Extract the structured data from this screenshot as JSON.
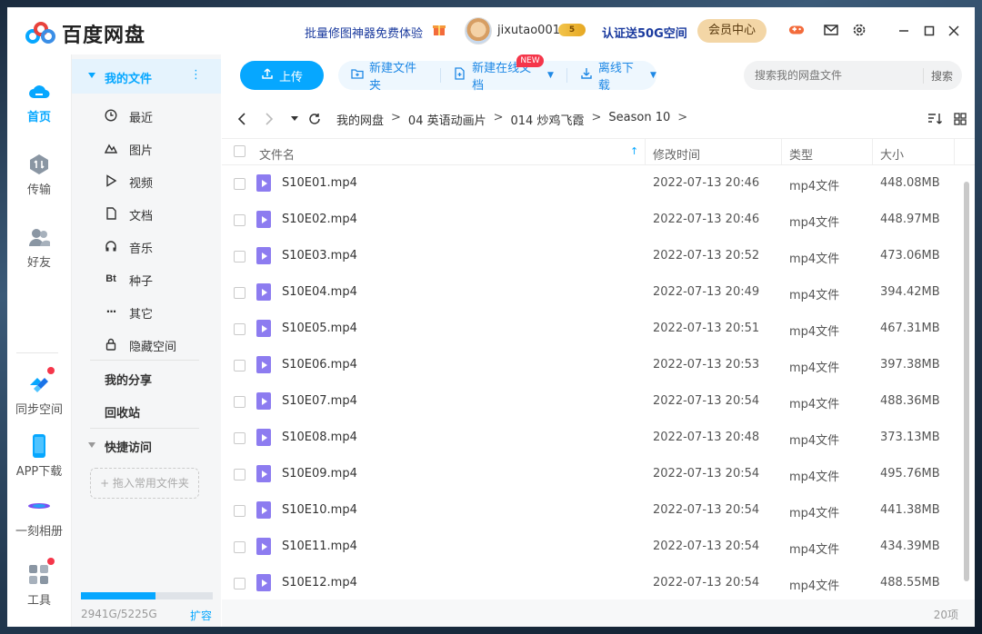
{
  "app": {
    "title": "百度网盘"
  },
  "header": {
    "promo": "批量修图神器免费体验",
    "username": "jixutao001",
    "level": "5",
    "verify_text": "认证送50G空间",
    "vip_button": "会员中心"
  },
  "rail": {
    "items": [
      {
        "label": "首页",
        "icon": "cloud-home-icon"
      },
      {
        "label": "传输",
        "icon": "transfer-icon"
      },
      {
        "label": "好友",
        "icon": "friends-icon"
      },
      {
        "label": "同步空间",
        "icon": "sync-space-icon"
      },
      {
        "label": "APP下载",
        "icon": "phone-icon"
      },
      {
        "label": "一刻相册",
        "icon": "album-icon"
      },
      {
        "label": "工具",
        "icon": "tools-icon"
      }
    ]
  },
  "sidebar": {
    "my_files": "我的文件",
    "sub_items": [
      {
        "label": "最近",
        "icon": "clock-icon"
      },
      {
        "label": "图片",
        "icon": "image-icon"
      },
      {
        "label": "视频",
        "icon": "video-icon"
      },
      {
        "label": "文档",
        "icon": "document-icon"
      },
      {
        "label": "音乐",
        "icon": "music-icon"
      },
      {
        "label": "种子",
        "icon": "torrent-icon"
      },
      {
        "label": "其它",
        "icon": "more-icon"
      },
      {
        "label": "隐藏空间",
        "icon": "lock-icon"
      }
    ],
    "my_share": "我的分享",
    "recycle": "回收站",
    "quick_access": "快捷访问",
    "drop_hint": "+ 拖入常用文件夹",
    "storage_text": "2941G/5225G",
    "storage_used_fraction": 0.563,
    "expand": "扩容"
  },
  "toolbar": {
    "upload": "上传",
    "new_folder": "新建文件夹",
    "new_online_doc": "新建在线文档",
    "new_badge": "NEW",
    "offline_download": "离线下载",
    "search_placeholder": "搜索我的网盘文件",
    "search_button": "搜索"
  },
  "breadcrumb": [
    "我的网盘",
    "04 英语动画片",
    "014 炒鸡飞霞",
    "Season 10"
  ],
  "table": {
    "headers": {
      "name": "文件名",
      "modified": "修改时间",
      "type": "类型",
      "size": "大小"
    },
    "rows": [
      {
        "name": "S10E01.mp4",
        "time": "2022-07-13 20:46",
        "type": "mp4文件",
        "size": "448.08MB"
      },
      {
        "name": "S10E02.mp4",
        "time": "2022-07-13 20:46",
        "type": "mp4文件",
        "size": "448.97MB"
      },
      {
        "name": "S10E03.mp4",
        "time": "2022-07-13 20:52",
        "type": "mp4文件",
        "size": "473.06MB"
      },
      {
        "name": "S10E04.mp4",
        "time": "2022-07-13 20:49",
        "type": "mp4文件",
        "size": "394.42MB"
      },
      {
        "name": "S10E05.mp4",
        "time": "2022-07-13 20:51",
        "type": "mp4文件",
        "size": "467.31MB"
      },
      {
        "name": "S10E06.mp4",
        "time": "2022-07-13 20:53",
        "type": "mp4文件",
        "size": "397.38MB"
      },
      {
        "name": "S10E07.mp4",
        "time": "2022-07-13 20:54",
        "type": "mp4文件",
        "size": "488.36MB"
      },
      {
        "name": "S10E08.mp4",
        "time": "2022-07-13 20:48",
        "type": "mp4文件",
        "size": "373.13MB"
      },
      {
        "name": "S10E09.mp4",
        "time": "2022-07-13 20:54",
        "type": "mp4文件",
        "size": "495.76MB"
      },
      {
        "name": "S10E10.mp4",
        "time": "2022-07-13 20:54",
        "type": "mp4文件",
        "size": "441.38MB"
      },
      {
        "name": "S10E11.mp4",
        "time": "2022-07-13 20:54",
        "type": "mp4文件",
        "size": "434.39MB"
      },
      {
        "name": "S10E12.mp4",
        "time": "2022-07-13 20:54",
        "type": "mp4文件",
        "size": "488.55MB"
      }
    ]
  },
  "footer": {
    "count": "20项"
  },
  "colors": {
    "accent": "#06a7ff",
    "brand_red": "#f5364a",
    "video_file": "#8d7cf0"
  }
}
